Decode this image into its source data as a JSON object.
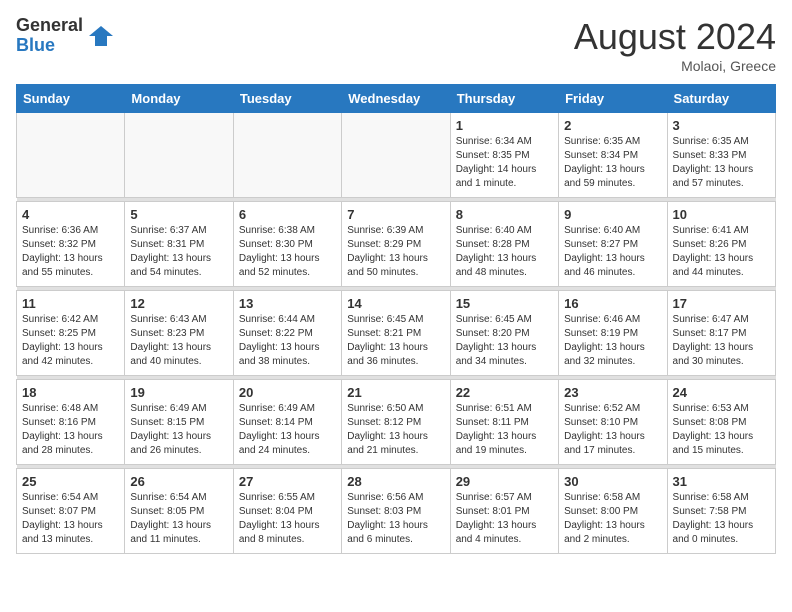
{
  "header": {
    "logo_general": "General",
    "logo_blue": "Blue",
    "month_year": "August 2024",
    "location": "Molaoi, Greece"
  },
  "days_of_week": [
    "Sunday",
    "Monday",
    "Tuesday",
    "Wednesday",
    "Thursday",
    "Friday",
    "Saturday"
  ],
  "weeks": [
    {
      "cells": [
        {
          "day": "",
          "content": ""
        },
        {
          "day": "",
          "content": ""
        },
        {
          "day": "",
          "content": ""
        },
        {
          "day": "",
          "content": ""
        },
        {
          "day": "1",
          "content": "Sunrise: 6:34 AM\nSunset: 8:35 PM\nDaylight: 14 hours\nand 1 minute."
        },
        {
          "day": "2",
          "content": "Sunrise: 6:35 AM\nSunset: 8:34 PM\nDaylight: 13 hours\nand 59 minutes."
        },
        {
          "day": "3",
          "content": "Sunrise: 6:35 AM\nSunset: 8:33 PM\nDaylight: 13 hours\nand 57 minutes."
        }
      ]
    },
    {
      "cells": [
        {
          "day": "4",
          "content": "Sunrise: 6:36 AM\nSunset: 8:32 PM\nDaylight: 13 hours\nand 55 minutes."
        },
        {
          "day": "5",
          "content": "Sunrise: 6:37 AM\nSunset: 8:31 PM\nDaylight: 13 hours\nand 54 minutes."
        },
        {
          "day": "6",
          "content": "Sunrise: 6:38 AM\nSunset: 8:30 PM\nDaylight: 13 hours\nand 52 minutes."
        },
        {
          "day": "7",
          "content": "Sunrise: 6:39 AM\nSunset: 8:29 PM\nDaylight: 13 hours\nand 50 minutes."
        },
        {
          "day": "8",
          "content": "Sunrise: 6:40 AM\nSunset: 8:28 PM\nDaylight: 13 hours\nand 48 minutes."
        },
        {
          "day": "9",
          "content": "Sunrise: 6:40 AM\nSunset: 8:27 PM\nDaylight: 13 hours\nand 46 minutes."
        },
        {
          "day": "10",
          "content": "Sunrise: 6:41 AM\nSunset: 8:26 PM\nDaylight: 13 hours\nand 44 minutes."
        }
      ]
    },
    {
      "cells": [
        {
          "day": "11",
          "content": "Sunrise: 6:42 AM\nSunset: 8:25 PM\nDaylight: 13 hours\nand 42 minutes."
        },
        {
          "day": "12",
          "content": "Sunrise: 6:43 AM\nSunset: 8:23 PM\nDaylight: 13 hours\nand 40 minutes."
        },
        {
          "day": "13",
          "content": "Sunrise: 6:44 AM\nSunset: 8:22 PM\nDaylight: 13 hours\nand 38 minutes."
        },
        {
          "day": "14",
          "content": "Sunrise: 6:45 AM\nSunset: 8:21 PM\nDaylight: 13 hours\nand 36 minutes."
        },
        {
          "day": "15",
          "content": "Sunrise: 6:45 AM\nSunset: 8:20 PM\nDaylight: 13 hours\nand 34 minutes."
        },
        {
          "day": "16",
          "content": "Sunrise: 6:46 AM\nSunset: 8:19 PM\nDaylight: 13 hours\nand 32 minutes."
        },
        {
          "day": "17",
          "content": "Sunrise: 6:47 AM\nSunset: 8:17 PM\nDaylight: 13 hours\nand 30 minutes."
        }
      ]
    },
    {
      "cells": [
        {
          "day": "18",
          "content": "Sunrise: 6:48 AM\nSunset: 8:16 PM\nDaylight: 13 hours\nand 28 minutes."
        },
        {
          "day": "19",
          "content": "Sunrise: 6:49 AM\nSunset: 8:15 PM\nDaylight: 13 hours\nand 26 minutes."
        },
        {
          "day": "20",
          "content": "Sunrise: 6:49 AM\nSunset: 8:14 PM\nDaylight: 13 hours\nand 24 minutes."
        },
        {
          "day": "21",
          "content": "Sunrise: 6:50 AM\nSunset: 8:12 PM\nDaylight: 13 hours\nand 21 minutes."
        },
        {
          "day": "22",
          "content": "Sunrise: 6:51 AM\nSunset: 8:11 PM\nDaylight: 13 hours\nand 19 minutes."
        },
        {
          "day": "23",
          "content": "Sunrise: 6:52 AM\nSunset: 8:10 PM\nDaylight: 13 hours\nand 17 minutes."
        },
        {
          "day": "24",
          "content": "Sunrise: 6:53 AM\nSunset: 8:08 PM\nDaylight: 13 hours\nand 15 minutes."
        }
      ]
    },
    {
      "cells": [
        {
          "day": "25",
          "content": "Sunrise: 6:54 AM\nSunset: 8:07 PM\nDaylight: 13 hours\nand 13 minutes."
        },
        {
          "day": "26",
          "content": "Sunrise: 6:54 AM\nSunset: 8:05 PM\nDaylight: 13 hours\nand 11 minutes."
        },
        {
          "day": "27",
          "content": "Sunrise: 6:55 AM\nSunset: 8:04 PM\nDaylight: 13 hours\nand 8 minutes."
        },
        {
          "day": "28",
          "content": "Sunrise: 6:56 AM\nSunset: 8:03 PM\nDaylight: 13 hours\nand 6 minutes."
        },
        {
          "day": "29",
          "content": "Sunrise: 6:57 AM\nSunset: 8:01 PM\nDaylight: 13 hours\nand 4 minutes."
        },
        {
          "day": "30",
          "content": "Sunrise: 6:58 AM\nSunset: 8:00 PM\nDaylight: 13 hours\nand 2 minutes."
        },
        {
          "day": "31",
          "content": "Sunrise: 6:58 AM\nSunset: 7:58 PM\nDaylight: 13 hours\nand 0 minutes."
        }
      ]
    }
  ]
}
